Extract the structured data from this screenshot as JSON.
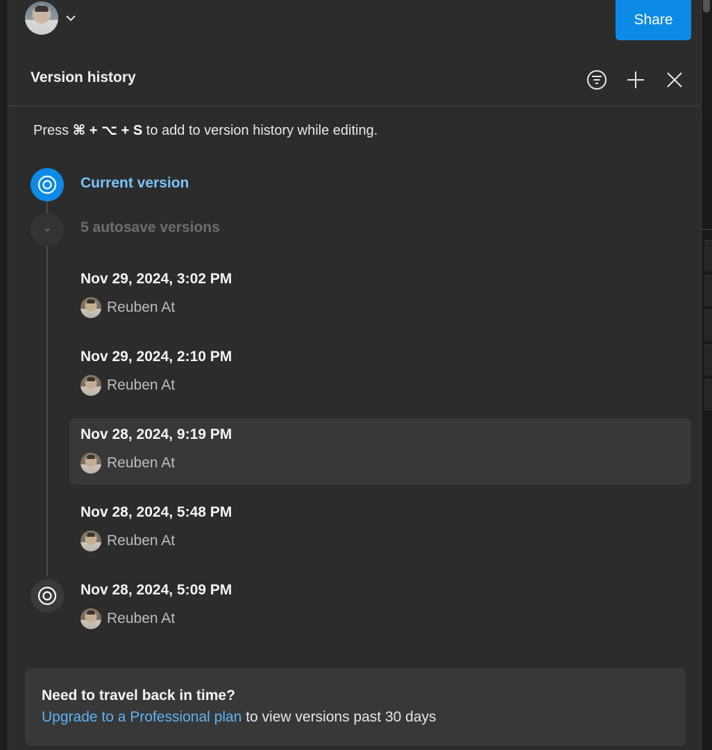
{
  "topbar": {
    "share_label": "Share",
    "avatar_icon": "user-avatar",
    "menu_icon": "chevron-down-icon"
  },
  "panel": {
    "title": "Version history",
    "icons": [
      "filter-icon",
      "plus-icon",
      "close-icon"
    ]
  },
  "hint": {
    "prefix": "Press ",
    "shortcut": "⌘ + ⌥ + S",
    "suffix": " to add to version history while editing."
  },
  "timeline": {
    "current_label": "Current version",
    "autosave_label": "5 autosave versions",
    "versions": [
      {
        "date": "Nov 29, 2024, 3:02 PM",
        "author": "Reuben At",
        "selected": false
      },
      {
        "date": "Nov 29, 2024, 2:10 PM",
        "author": "Reuben At",
        "selected": false
      },
      {
        "date": "Nov 28, 2024, 9:19 PM",
        "author": "Reuben At",
        "selected": true
      },
      {
        "date": "Nov 28, 2024, 5:48 PM",
        "author": "Reuben At",
        "selected": false
      },
      {
        "date": "Nov 28, 2024, 5:09 PM",
        "author": "Reuben At",
        "selected": false
      }
    ]
  },
  "upgrade": {
    "title": "Need to travel back in time?",
    "link_text": "Upgrade to a Professional plan",
    "rest_text": " to view versions past 30 days"
  },
  "colors": {
    "accent": "#0d8ae6",
    "link": "#5fb2f5",
    "panel_bg": "#2c2c2c"
  }
}
